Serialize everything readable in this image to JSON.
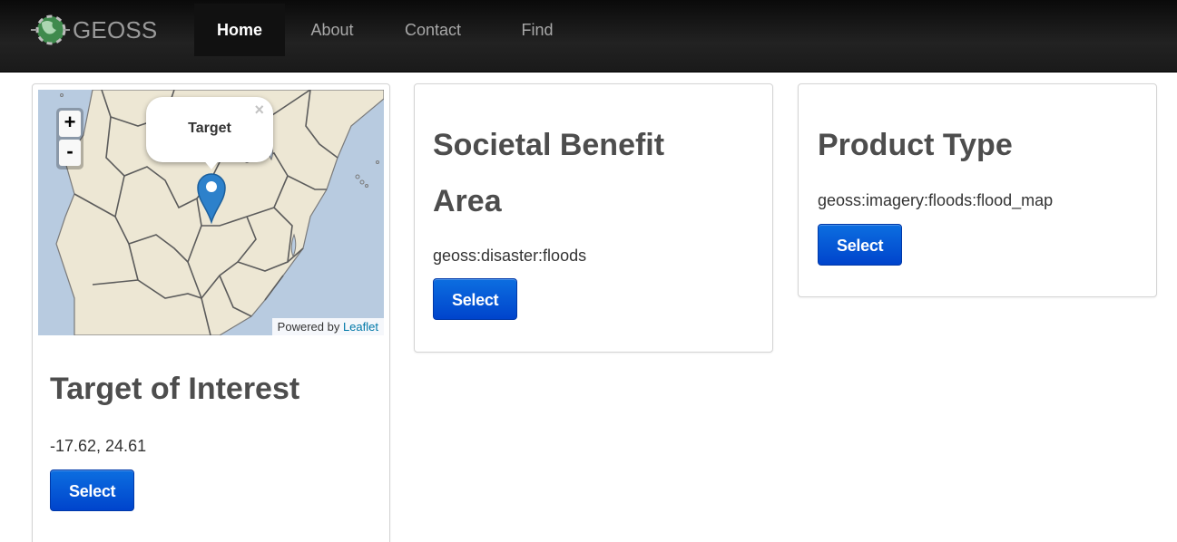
{
  "navbar": {
    "brand": "GEOSS",
    "items": [
      {
        "label": "Home",
        "active": true
      },
      {
        "label": "About",
        "active": false
      },
      {
        "label": "Contact",
        "active": false
      },
      {
        "label": "Find",
        "active": false
      }
    ]
  },
  "map": {
    "zoom_in": "+",
    "zoom_out": "-",
    "popup_title": "Target",
    "popup_close": "×",
    "attribution_prefix": "Powered by",
    "attribution_link": "Leaflet",
    "marker_color": "#2d81cb"
  },
  "target_card": {
    "title": "Target of Interest",
    "value": "-17.62, 24.61",
    "button": "Select"
  },
  "sba_card": {
    "title_line1": "Societal Benefit",
    "title_line2": "Area",
    "value": "geoss:disaster:floods",
    "button": "Select"
  },
  "product_card": {
    "title": "Product Type",
    "value": "geoss:imagery:floods:flood_map",
    "button": "Select"
  },
  "colors": {
    "navbar_bg": "#1b1b1b",
    "button_bg": "#0055d4",
    "land": "#ede7d4",
    "water": "#b8cbe0"
  }
}
